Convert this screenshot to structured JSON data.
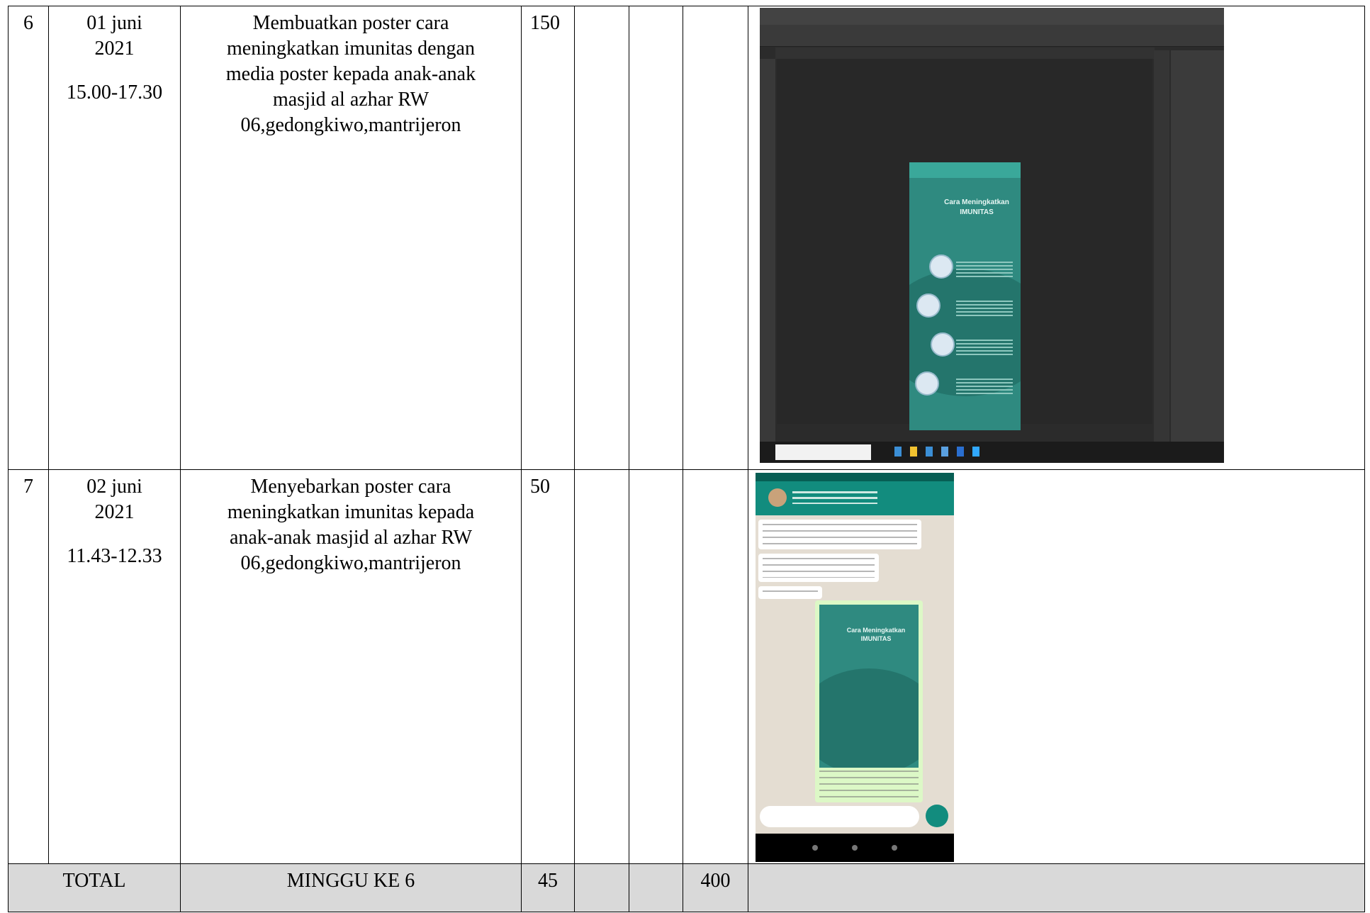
{
  "rows": [
    {
      "no": "6",
      "date": "01 juni",
      "year": "2021",
      "time": "15.00-17.30",
      "desc": [
        "Membuatkan poster cara",
        "meningkatkan imunitas dengan",
        "media poster kepada anak-anak",
        "masjid al azhar RW",
        "06,gedongkiwo,mantrijeron"
      ],
      "minutes": "150"
    },
    {
      "no": "7",
      "date": "02 juni",
      "year": "2021",
      "time": "11.43-12.33",
      "desc": [
        "Menyebarkan poster cara",
        "meningkatkan imunitas kepada",
        "anak-anak masjid al azhar RW",
        "06,gedongkiwo,mantrijeron"
      ],
      "minutes": "50"
    }
  ],
  "total": {
    "label": "TOTAL",
    "week": "MINGGU KE 6",
    "minutes": "45",
    "sum": "400"
  },
  "poster": {
    "title_line1": "Cara Meningkatkan",
    "title_line2": "IMUNITAS"
  },
  "colors": {
    "total_bg": "#d9d9d9",
    "poster_teal": "#2f8a80",
    "whatsapp_green": "#128c7e"
  }
}
